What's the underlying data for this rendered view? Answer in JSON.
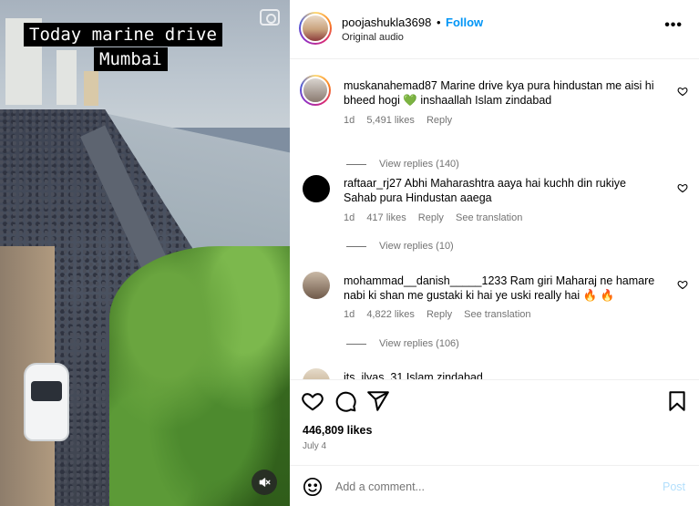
{
  "media": {
    "caption_line1": "Today marine drive",
    "caption_line2": "Mumbai",
    "icons": {
      "top_right": "camera-icon",
      "bottom_right": "mute-icon"
    }
  },
  "header": {
    "username": "poojashukla3698",
    "separator": "•",
    "follow_label": "Follow",
    "audio": "Original audio",
    "more_label": "•••"
  },
  "comments": [
    {
      "username": "muskanahemad87",
      "text": "Marine drive kya pura hindustan me aisi hi bheed hogi 💚 inshaallah Islam zindabad",
      "age": "1d",
      "likes": "5,491 likes",
      "reply": "Reply",
      "translation": "",
      "view_replies": "View replies (140)"
    },
    {
      "username": "raftaar_rj27",
      "text": "Abhi Maharashtra aaya hai kuchh din rukiye Sahab pura Hindustan aaega",
      "age": "1d",
      "likes": "417 likes",
      "reply": "Reply",
      "translation": "See translation",
      "view_replies": "View replies (10)"
    },
    {
      "username": "mohammad__danish_____1233",
      "text": "Ram giri Maharaj ne hamare nabi ki shan me gustaki ki hai ye uski really hai 🔥 🔥",
      "age": "1d",
      "likes": "4,822 likes",
      "reply": "Reply",
      "translation": "See translation",
      "view_replies": "View replies (106)"
    },
    {
      "username": "its_ilyas_31",
      "text": "Islam zindabad"
    }
  ],
  "actions": {
    "icons": [
      "heart-icon",
      "comment-icon",
      "share-icon",
      "bookmark-icon"
    ],
    "likes": "446,809 likes",
    "date": "July 4"
  },
  "composer": {
    "placeholder": "Add a comment...",
    "post_label": "Post"
  },
  "colors": {
    "accent": "#0095f6",
    "muted": "#737373",
    "post_disabled": "#b2dffc"
  }
}
